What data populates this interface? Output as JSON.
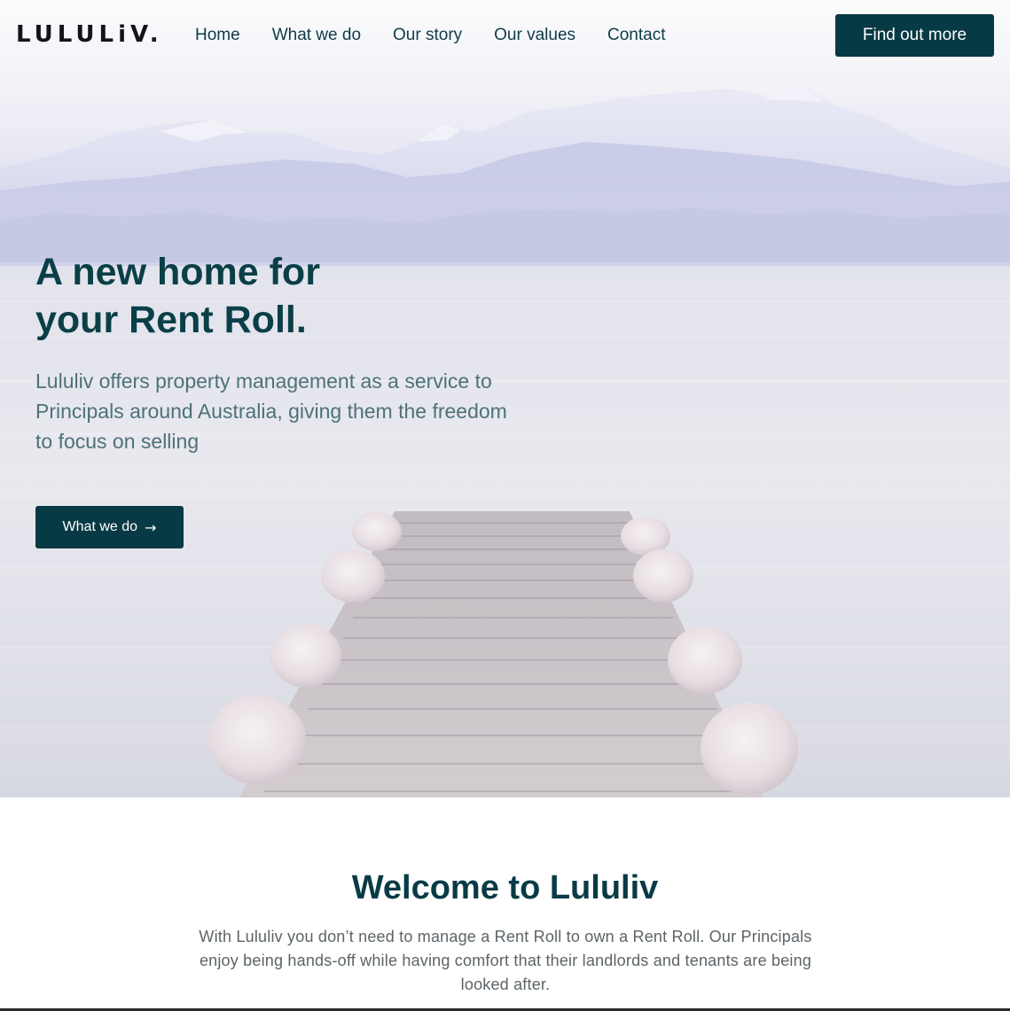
{
  "brand": {
    "logo": "LULULiV."
  },
  "nav": {
    "links": [
      "Home",
      "What we do",
      "Our story",
      "Our values",
      "Contact"
    ],
    "cta": "Find out more"
  },
  "hero": {
    "title_line1": "A new home for",
    "title_line2": "your Rent Roll.",
    "subtitle": "Lululiv offers property management as a service to Principals around Australia, giving them the freedom to focus on selling",
    "button_label": "What we do",
    "button_icon": "→"
  },
  "welcome": {
    "title": "Welcome to Lululiv",
    "text": "With Lululiv you don’t need to manage a Rent Roll to own a Rent Roll. Our Principals enjoy being hands-off while having comfort that their landlords and tenants are being looked after."
  },
  "colors": {
    "primary": "#073a44",
    "heading": "#0b3f48",
    "subtitle": "#4d7278",
    "body_text": "#5c6468"
  }
}
